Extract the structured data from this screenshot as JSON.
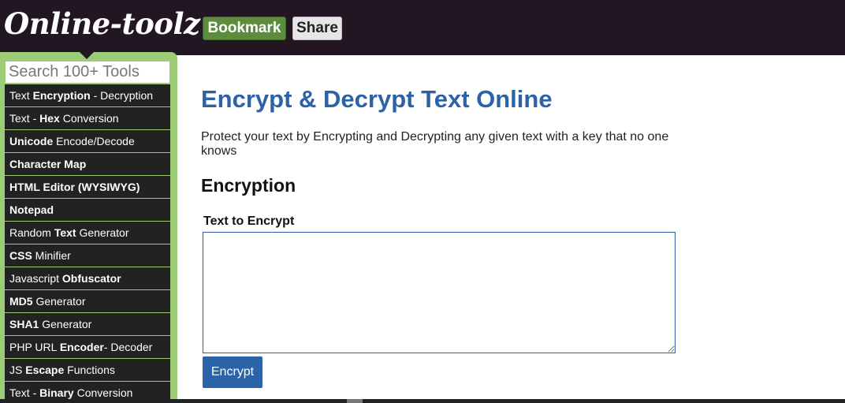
{
  "header": {
    "logo": "Online-toolz",
    "bookmark_label": "Bookmark",
    "share_label": "Share"
  },
  "sidebar": {
    "search_placeholder": "Search 100+ Tools",
    "items": [
      {
        "parts": [
          [
            "Text ",
            false
          ],
          [
            "Encryption",
            true
          ],
          [
            " - Decryption",
            false
          ]
        ]
      },
      {
        "parts": [
          [
            "Text - ",
            false
          ],
          [
            "Hex",
            true
          ],
          [
            " Conversion",
            false
          ]
        ]
      },
      {
        "parts": [
          [
            "Unicode",
            true
          ],
          [
            " Encode/Decode",
            false
          ]
        ]
      },
      {
        "parts": [
          [
            "Character Map",
            true
          ]
        ]
      },
      {
        "parts": [
          [
            "HTML Editor (WYSIWYG)",
            true
          ]
        ]
      },
      {
        "parts": [
          [
            "Notepad",
            true
          ]
        ]
      },
      {
        "parts": [
          [
            "Random ",
            false
          ],
          [
            "Text",
            true
          ],
          [
            " Generator",
            false
          ]
        ]
      },
      {
        "parts": [
          [
            "CSS",
            true
          ],
          [
            " Minifier",
            false
          ]
        ]
      },
      {
        "parts": [
          [
            "Javascript ",
            false
          ],
          [
            "Obfuscator",
            true
          ]
        ]
      },
      {
        "parts": [
          [
            "MD5",
            true
          ],
          [
            " Generator",
            false
          ]
        ]
      },
      {
        "parts": [
          [
            "SHA1",
            true
          ],
          [
            " Generator",
            false
          ]
        ]
      },
      {
        "parts": [
          [
            "PHP URL ",
            false
          ],
          [
            "Encoder",
            true
          ],
          [
            "- Decoder",
            false
          ]
        ]
      },
      {
        "parts": [
          [
            "JS ",
            false
          ],
          [
            "Escape",
            true
          ],
          [
            " Functions",
            false
          ]
        ]
      },
      {
        "parts": [
          [
            "Text - ",
            false
          ],
          [
            "Binary",
            true
          ],
          [
            " Conversion",
            false
          ]
        ]
      }
    ]
  },
  "main": {
    "title": "Encrypt & Decrypt Text Online",
    "description": "Protect your text by Encrypting and Decrypting any given text with a key that no one knows",
    "section_title": "Encryption",
    "field_label": "Text to Encrypt",
    "textarea_value": "",
    "encrypt_label": "Encrypt"
  },
  "colors": {
    "header_bg": "#231623",
    "sidebar_green": "#9ccc76",
    "sidebar_item_bg": "#222222",
    "title_blue": "#2b62a8",
    "bookmark_green": "#5d8c3e"
  }
}
